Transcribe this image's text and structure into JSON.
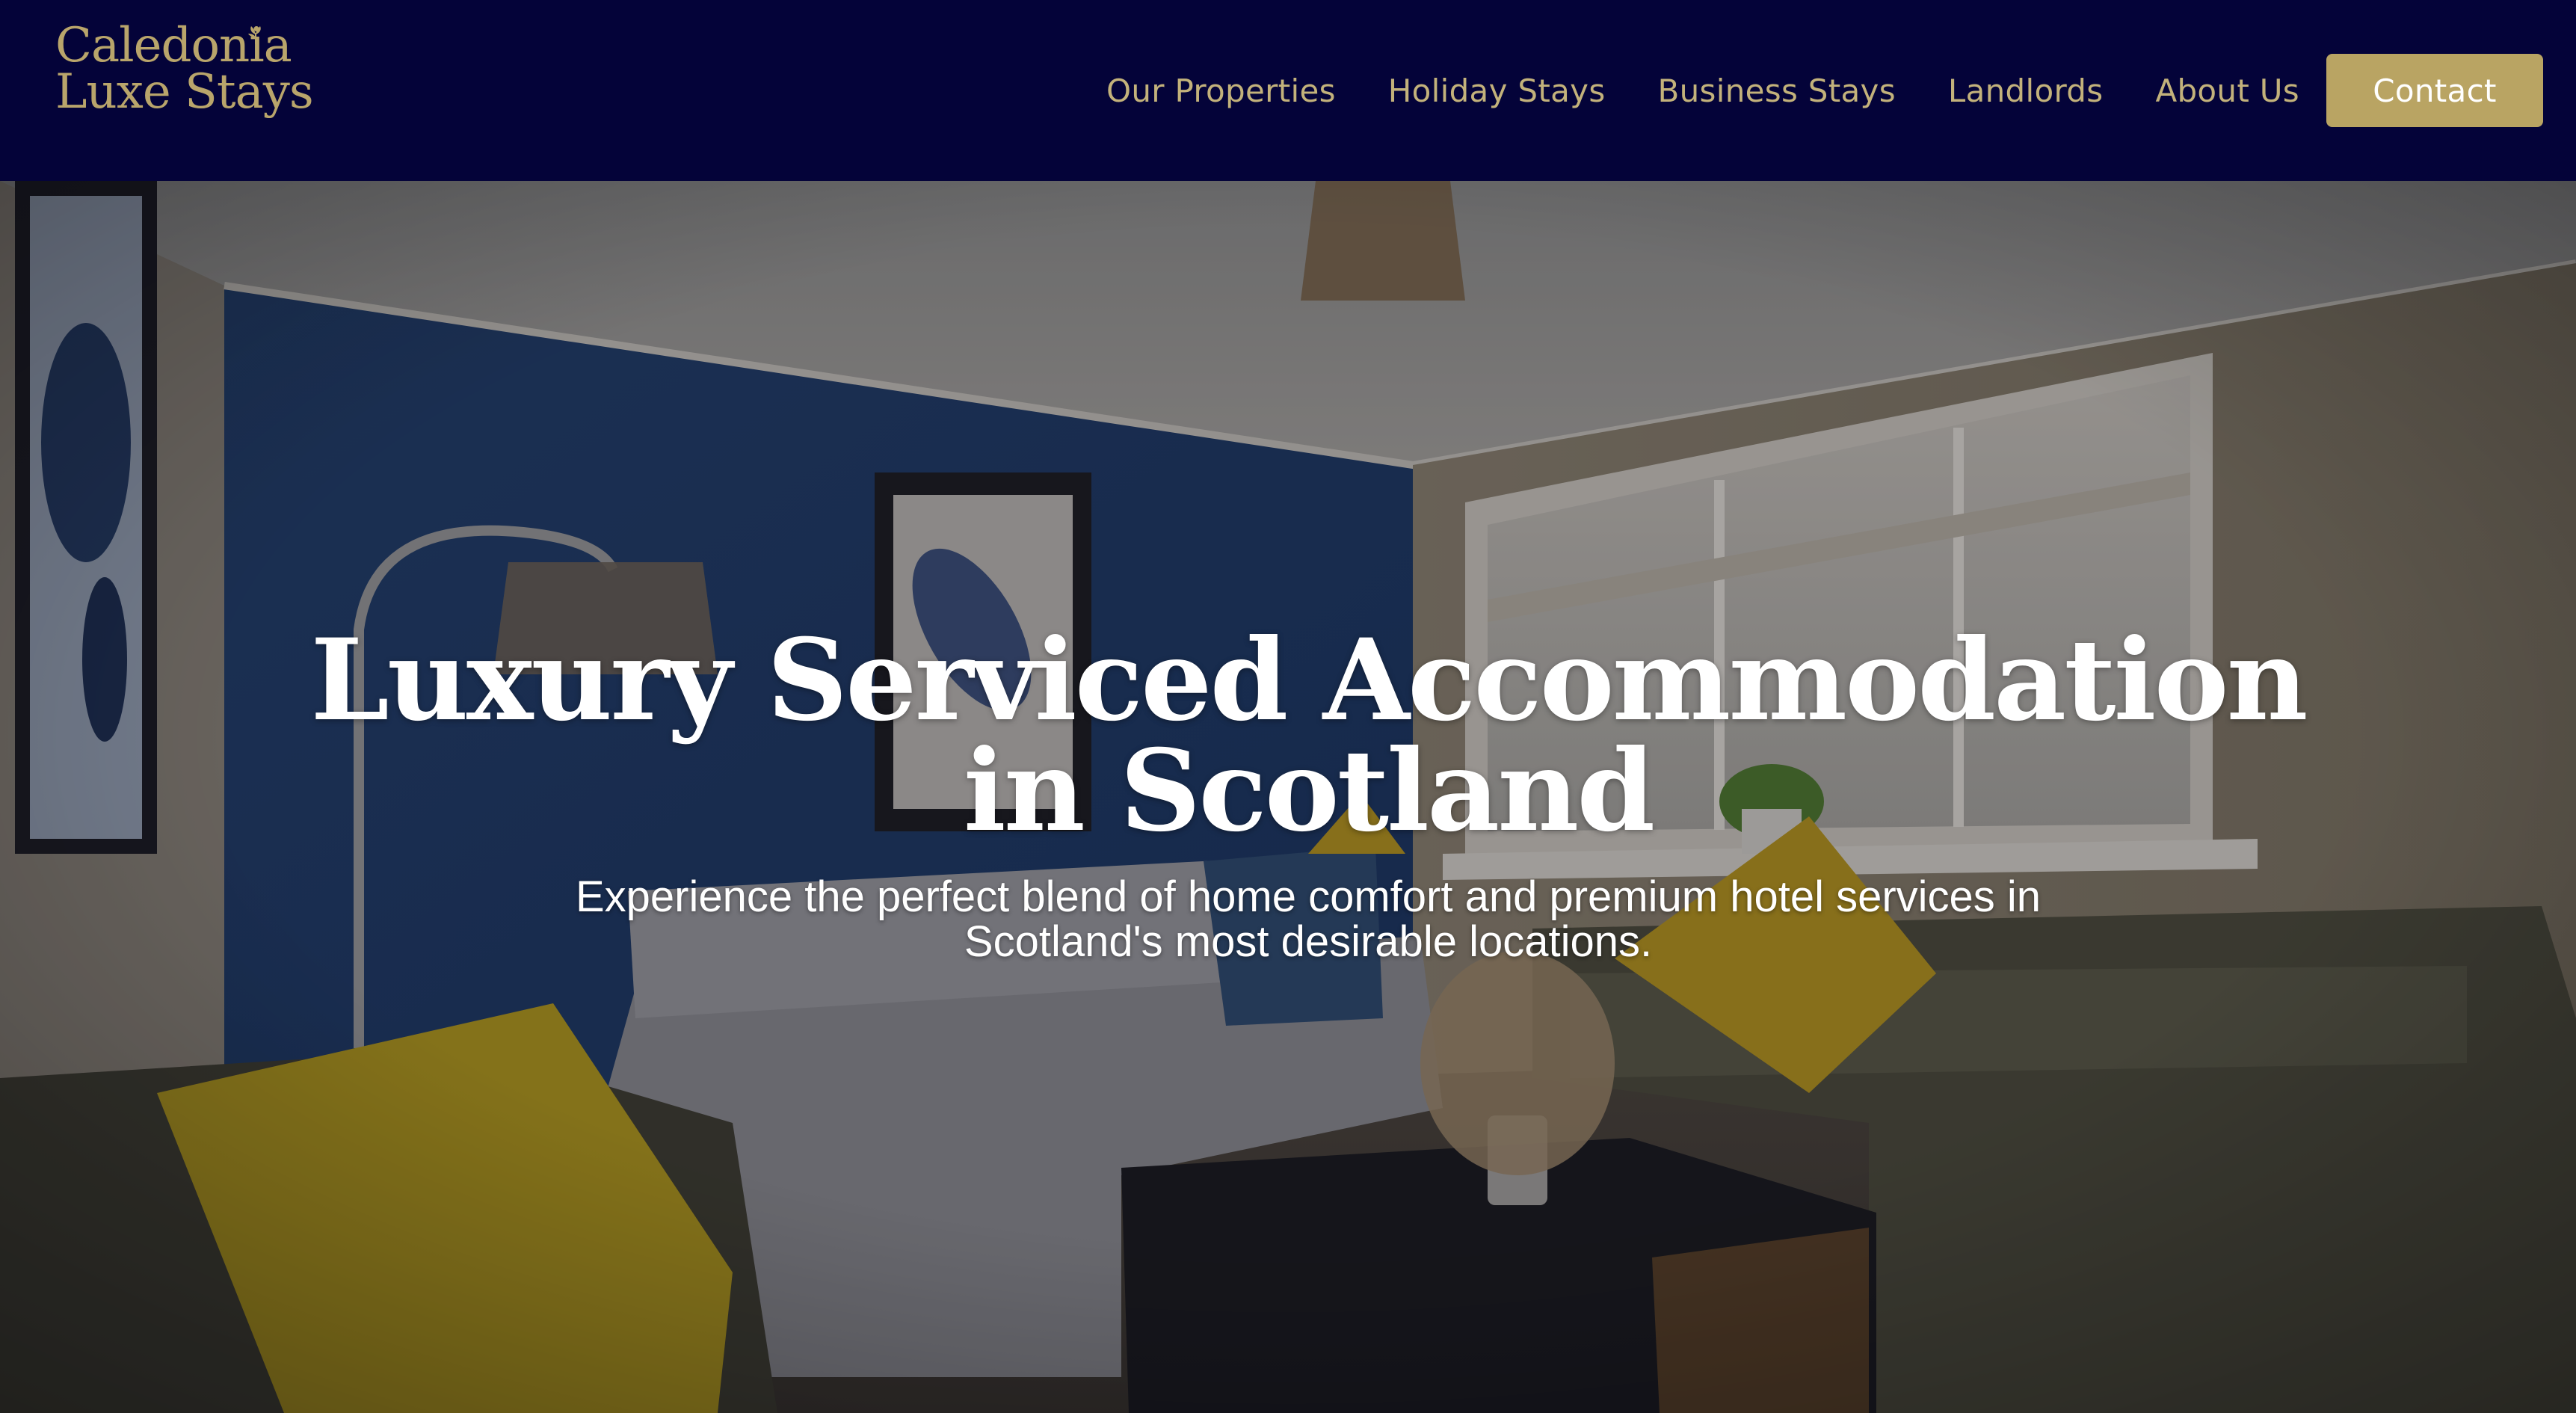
{
  "header": {
    "logo": {
      "line1": "Caledonia",
      "line2": "Luxe Stays"
    },
    "nav": [
      {
        "label": "Our Properties"
      },
      {
        "label": "Holiday Stays"
      },
      {
        "label": "Business Stays"
      },
      {
        "label": "Landlords"
      },
      {
        "label": "About Us"
      }
    ],
    "contact_label": "Contact"
  },
  "hero": {
    "title_line1": "Luxury Serviced Accommodation",
    "title_line2": "in Scotland",
    "subtitle_line1": "Experience the perfect blend of home comfort and premium hotel services in",
    "subtitle_line2": "Scotland's most desirable locations."
  },
  "colors": {
    "header_bg": "#040339",
    "brand_gold": "#b9a463",
    "nav_text": "#c3b27b",
    "hero_text": "#ffffff"
  },
  "icons": {
    "logo_mark": "thistle-sprig-icon"
  }
}
